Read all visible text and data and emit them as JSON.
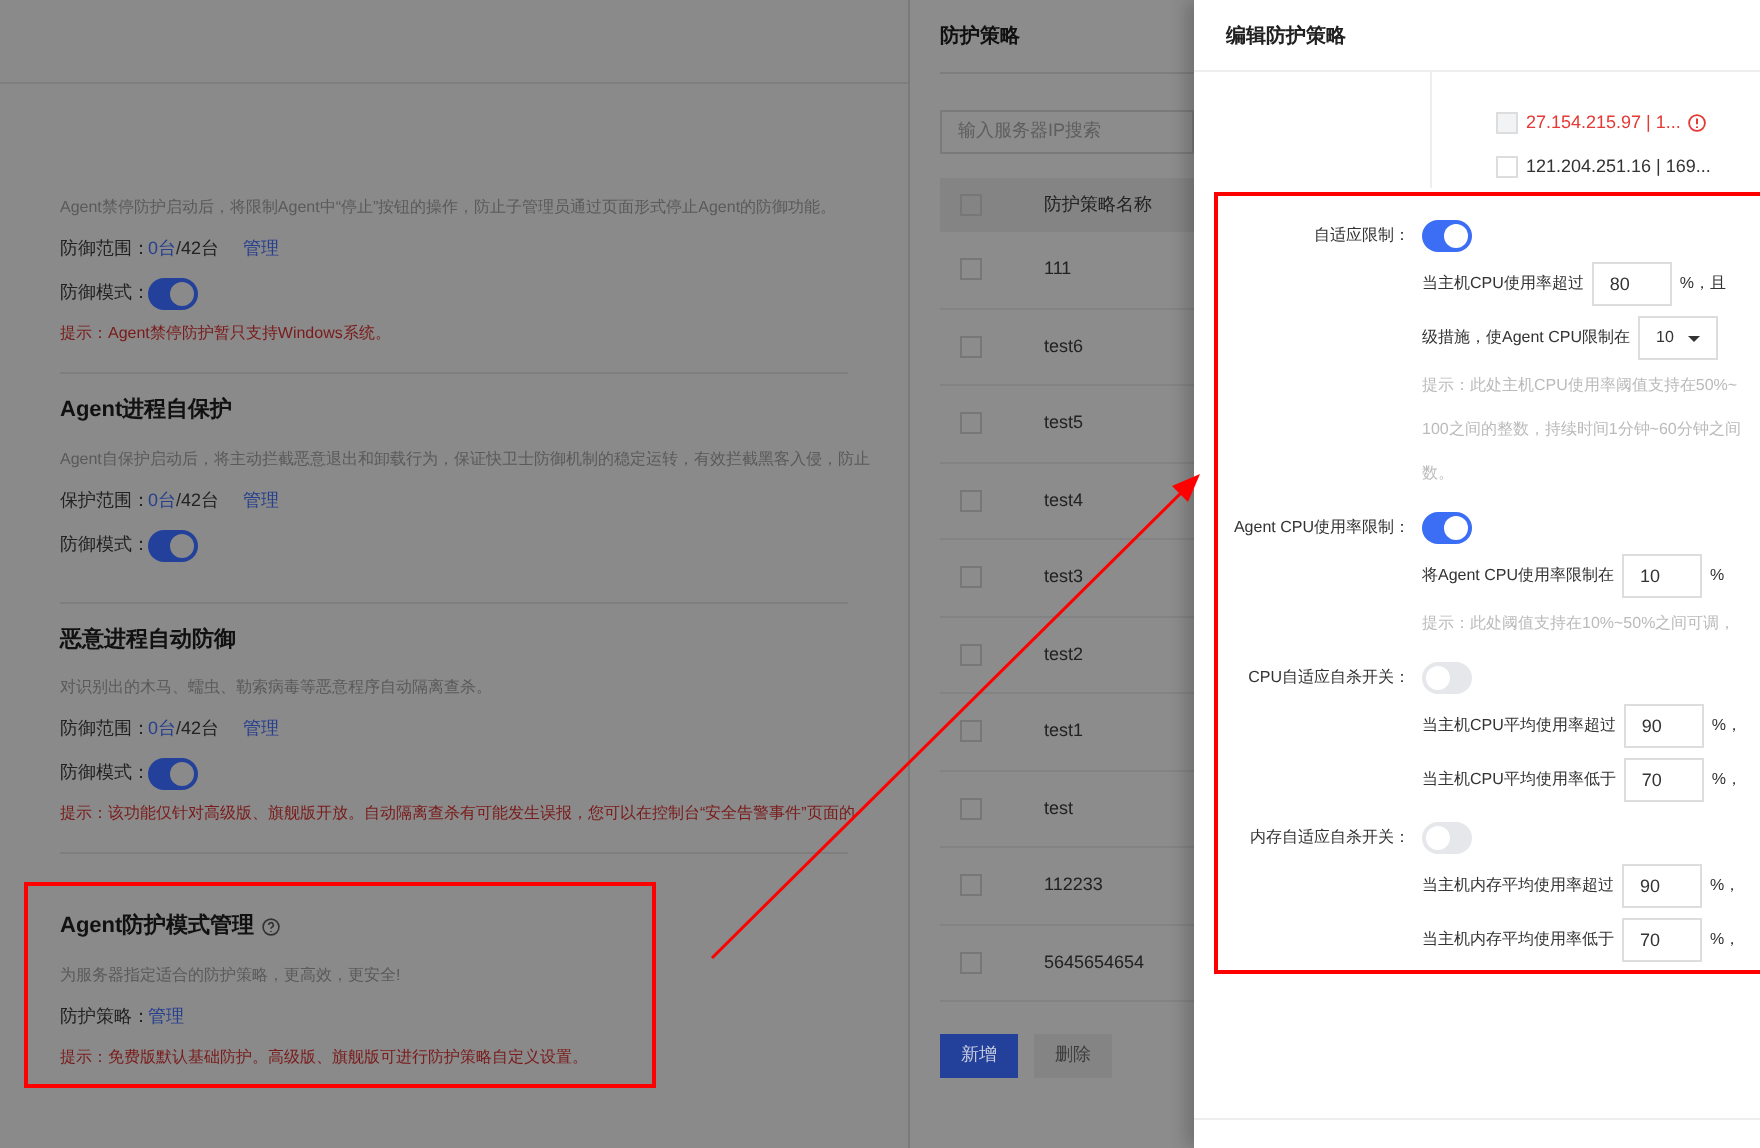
{
  "settings_page": {
    "sections": [
      {
        "description": "Agent禁停防护启动后，将限制Agent中“停止”按钮的操作，防止子管理员通过页面形式停止Agent的防御功能。",
        "rows": [
          {
            "kind": "scope",
            "label": "防御范围：",
            "count": "0台",
            "total": "/42台",
            "link": "管理"
          },
          {
            "kind": "toggle",
            "label": "防御模式：",
            "on": true
          }
        ],
        "hint": "提示：Agent禁停防护暂只支持Windows系统。",
        "highlighted": false
      },
      {
        "title": "Agent进程自保护",
        "description": "Agent自保护启动后，将主动拦截恶意退出和卸载行为，保证快卫士防御机制的稳定运转，有效拦截黑客入侵，防止",
        "rows": [
          {
            "kind": "scope",
            "label": "保护范围：",
            "count": "0台",
            "total": "/42台",
            "link": "管理"
          },
          {
            "kind": "toggle",
            "label": "防御模式：",
            "on": true
          }
        ],
        "highlighted": false,
        "help": false
      },
      {
        "title": "恶意进程自动防御",
        "description": "对识别出的木马、蠕虫、勒索病毒等恶意程序自动隔离查杀。",
        "rows": [
          {
            "kind": "scope",
            "label": "防御范围：",
            "count": "0台",
            "total": "/42台",
            "link": "管理"
          },
          {
            "kind": "toggle",
            "label": "防御模式：",
            "on": true
          }
        ],
        "hint": "提示：该功能仅针对高级版、旗舰版开放。自动隔离查杀有可能发生误报，您可以在控制台“安全告警事件”页面的",
        "highlighted": false,
        "help": false
      },
      {
        "title": "Agent防护模式管理",
        "description": "为服务器指定适合的防护策略，更高效，更安全!",
        "rows": [
          {
            "kind": "link",
            "label": "防护策略：",
            "link": "管理"
          }
        ],
        "hint": "提示：免费版默认基础防护。高级版、旗舰版可进行防护策略自定义设置。",
        "highlighted": true,
        "help": true
      }
    ]
  },
  "policy_drawer": {
    "title": "防护策略",
    "search": {
      "placeholder": "输入服务器IP搜索"
    },
    "column": "防护策略名称",
    "header_checked": false,
    "rows": [
      {
        "name": "111",
        "checked": false
      },
      {
        "name": "test6",
        "checked": false
      },
      {
        "name": "test5",
        "checked": false
      },
      {
        "name": "test4",
        "checked": false
      },
      {
        "name": "test3",
        "checked": false
      },
      {
        "name": "test2",
        "checked": false
      },
      {
        "name": "test1",
        "checked": false
      },
      {
        "name": "test",
        "checked": false
      },
      {
        "name": "112233",
        "checked": false
      },
      {
        "name": "5645654654",
        "checked": false
      }
    ],
    "buttons": [
      {
        "label": "新增",
        "disabled": false
      },
      {
        "label": "删除",
        "disabled": true
      }
    ]
  },
  "edit_drawer": {
    "title": "编辑防护策略",
    "servers": [
      {
        "label": "27.154.215.97 | 1...",
        "warning": true,
        "checked": false
      },
      {
        "label": "121.204.251.16 | 169...",
        "warning": false,
        "checked": false
      }
    ],
    "groups": [
      {
        "label": "自适应限制：",
        "on": true,
        "lines": [
          {
            "kind": "input",
            "before": "当主机CPU使用率超过",
            "value": "80",
            "after": "%，且"
          },
          {
            "kind": "select",
            "before": "级措施，使Agent CPU限制在",
            "value": "10"
          },
          {
            "kind": "note",
            "text": "提示：此处主机CPU使用率阈值支持在50%~"
          },
          {
            "kind": "note",
            "text": "100之间的整数，持续时间1分钟~60分钟之间"
          },
          {
            "kind": "note",
            "text": "数。"
          }
        ]
      },
      {
        "label": "Agent CPU使用率限制：",
        "on": true,
        "lines": [
          {
            "kind": "input",
            "before": "将Agent CPU使用率限制在",
            "value": "10",
            "after": "%"
          },
          {
            "kind": "note",
            "text": "提示：此处阈值支持在10%~50%之间可调，"
          }
        ]
      },
      {
        "label": "CPU自适应自杀开关：",
        "on": false,
        "lines": [
          {
            "kind": "input",
            "before": "当主机CPU平均使用率超过",
            "value": "90",
            "after": "%，"
          },
          {
            "kind": "input",
            "before": "当主机CPU平均使用率低于",
            "value": "70",
            "after": "%，"
          }
        ]
      },
      {
        "label": "内存自适应自杀开关：",
        "on": false,
        "lines": [
          {
            "kind": "input",
            "before": "当主机内存平均使用率超过",
            "value": "90",
            "after": "%，"
          },
          {
            "kind": "input",
            "before": "当主机内存平均使用率低于",
            "value": "70",
            "after": "%，"
          }
        ]
      }
    ]
  }
}
